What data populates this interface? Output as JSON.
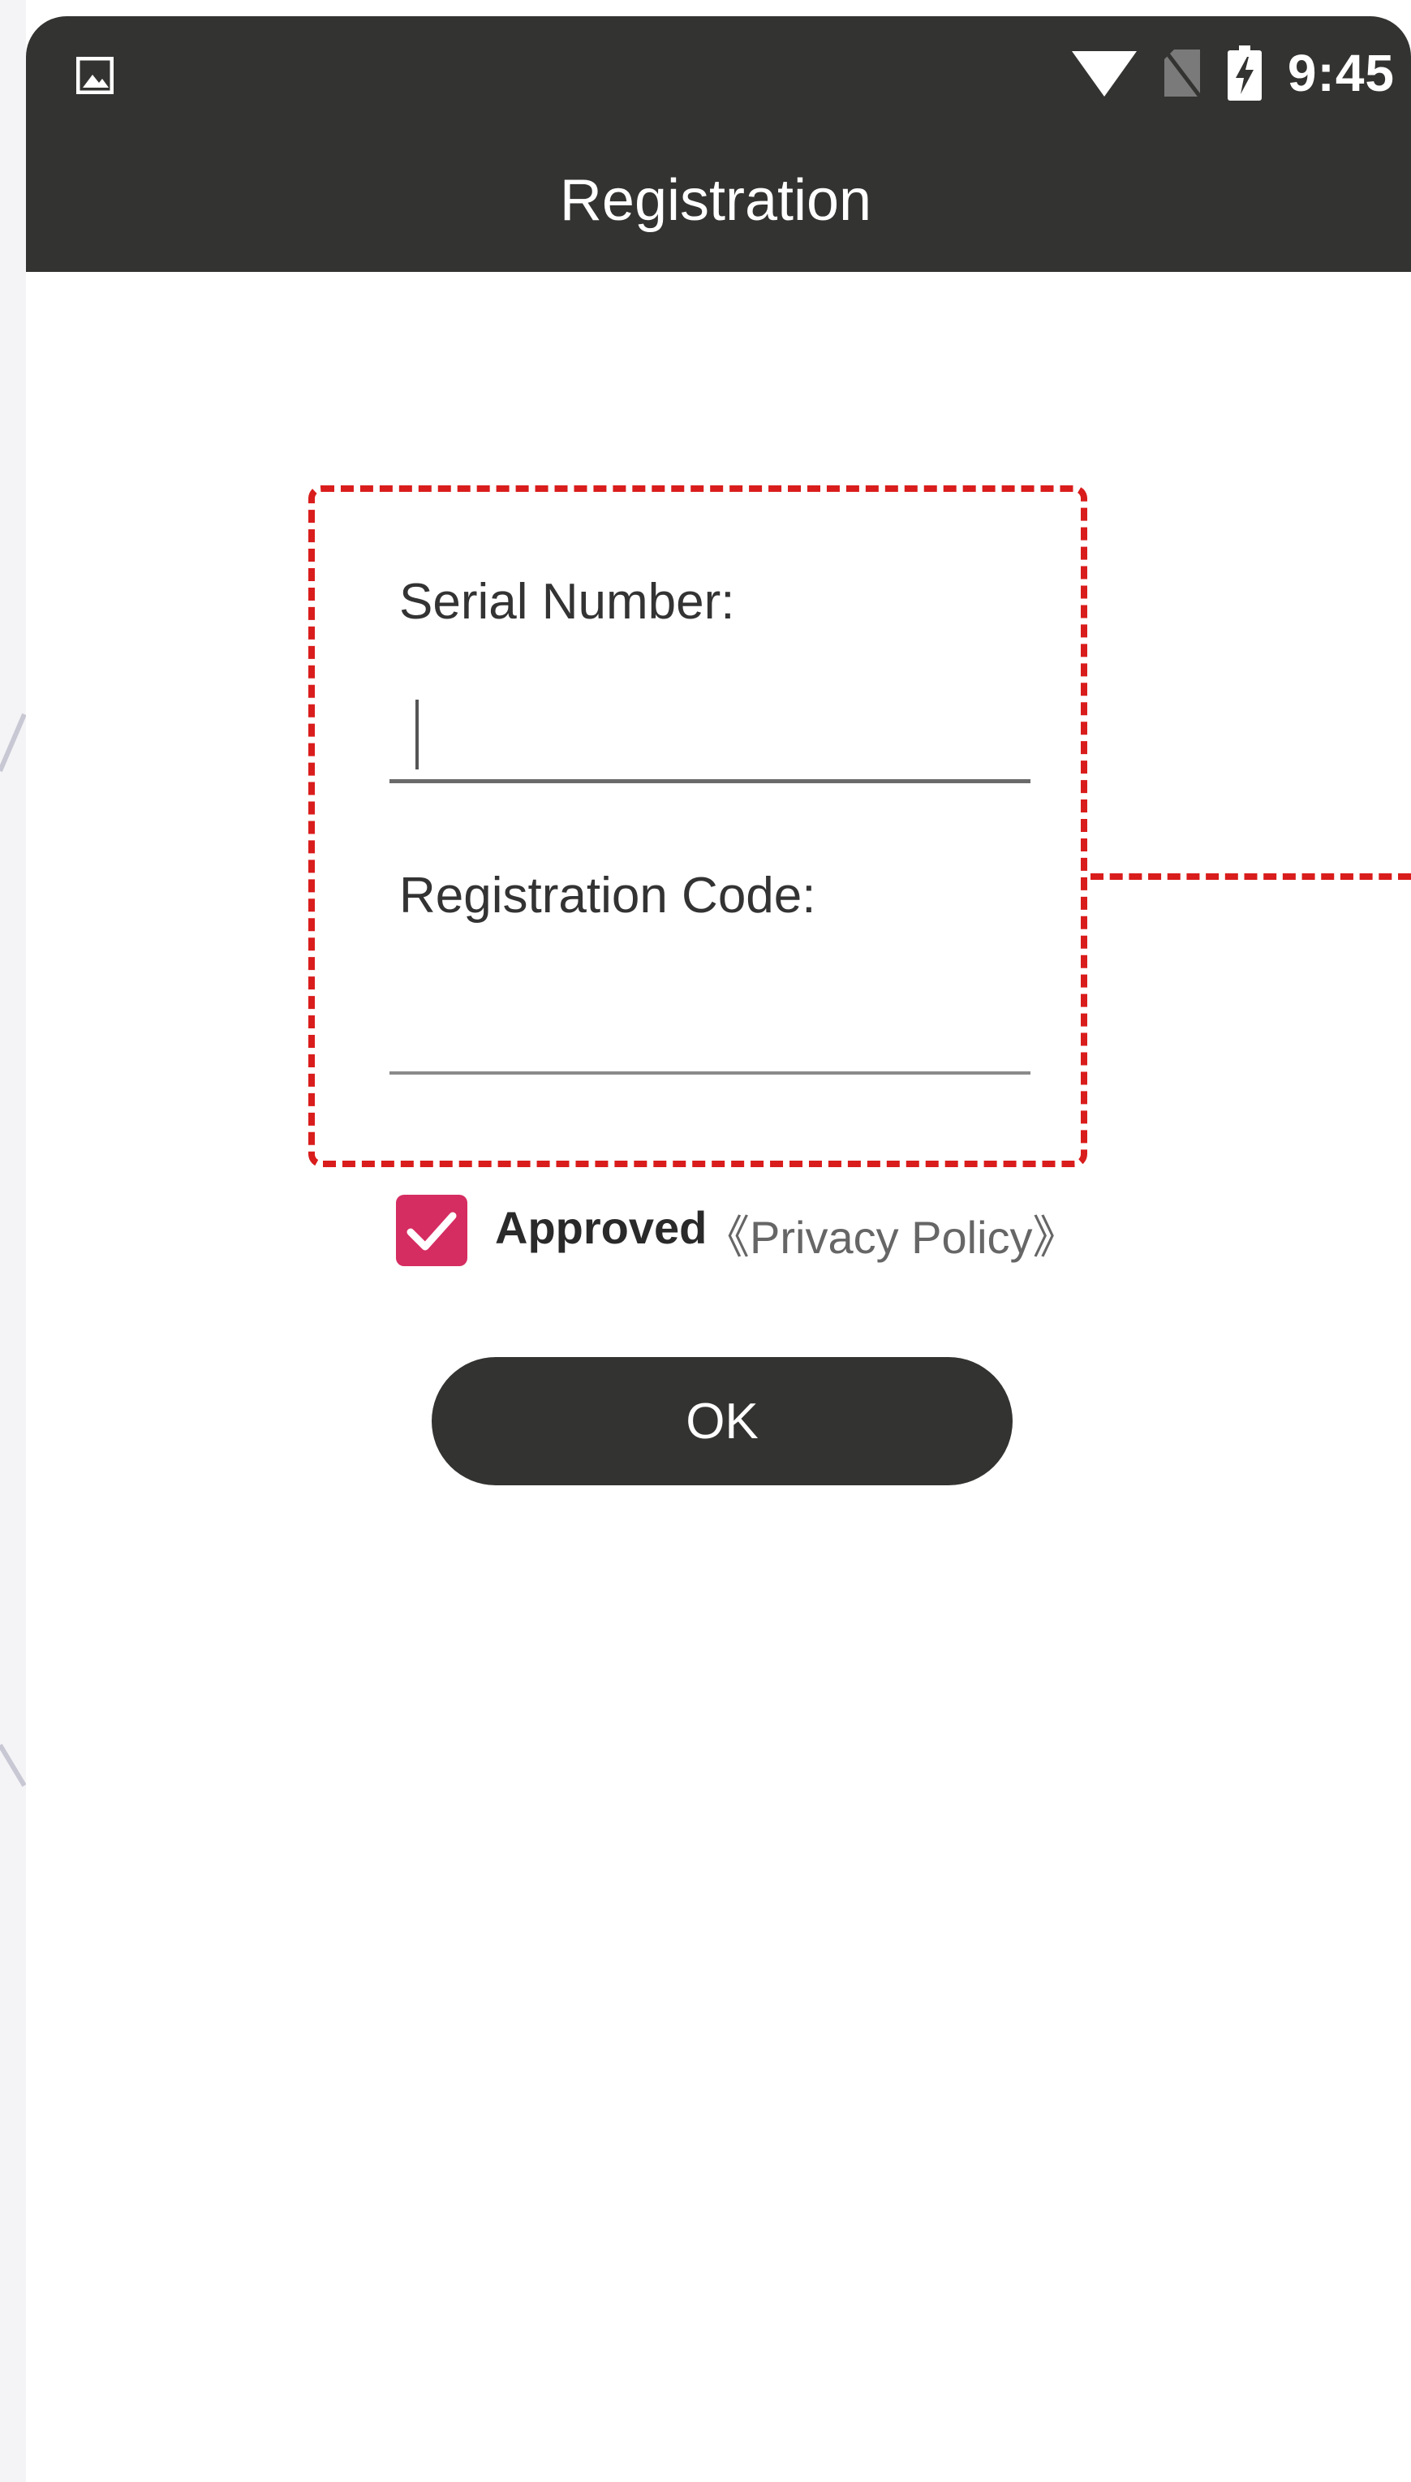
{
  "status_bar": {
    "time": "9:45",
    "icons": [
      "gallery-icon",
      "wifi-icon",
      "no-sim-icon",
      "battery-charging-icon"
    ]
  },
  "app_bar": {
    "title": "Registration"
  },
  "form": {
    "serial_label": "Serial Number:",
    "serial_value": "",
    "code_label": "Registration Code:",
    "code_value": ""
  },
  "consent": {
    "checked": true,
    "approved_label": "Approved",
    "policy_link": "《Privacy Policy》"
  },
  "actions": {
    "ok_label": "OK"
  },
  "colors": {
    "bar_background": "#333331",
    "checkbox": "#d52d62",
    "highlight": "#d91d1d"
  }
}
